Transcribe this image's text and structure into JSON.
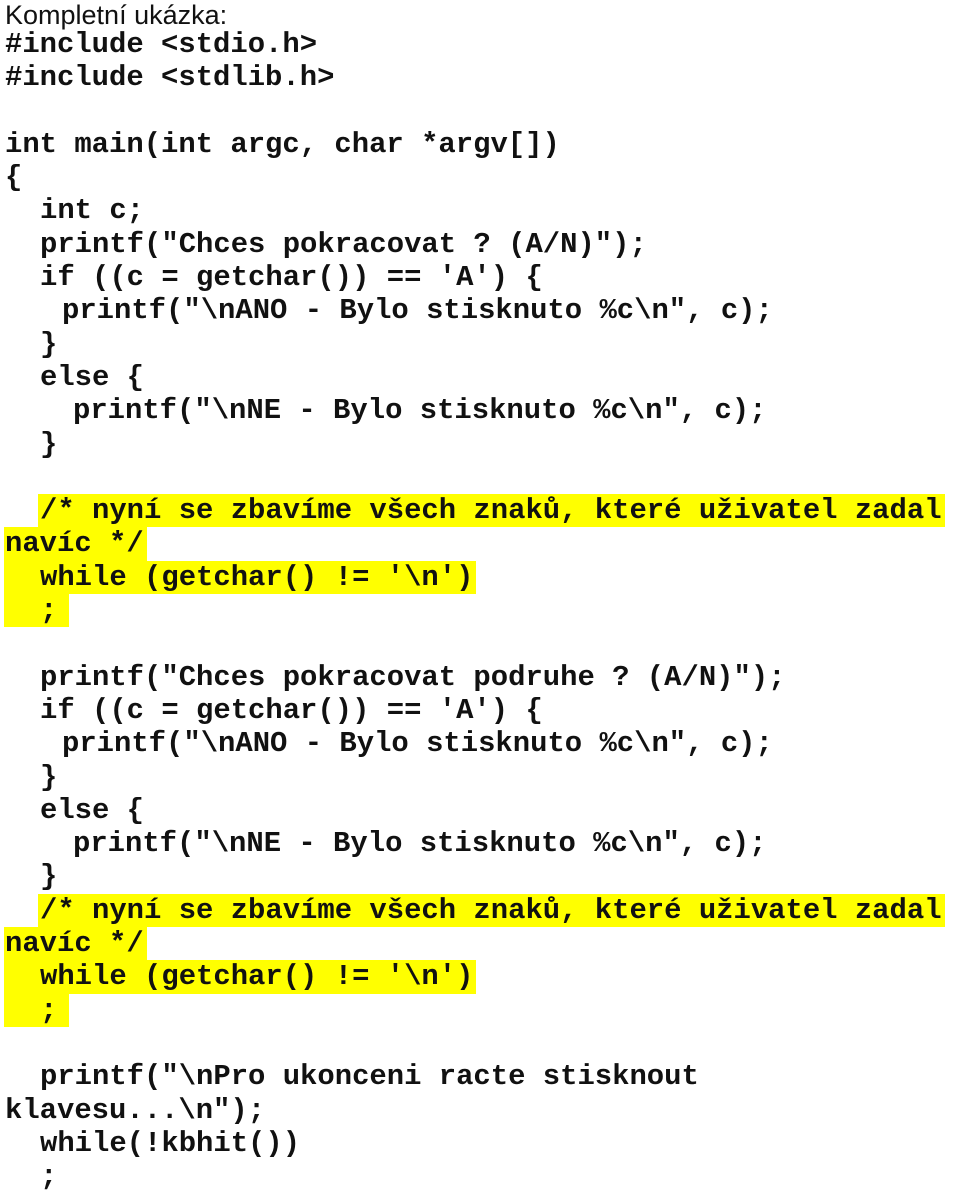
{
  "heading": "Kompletní ukázka:",
  "code": {
    "includes": [
      "#include <stdio.h>",
      "#include <stdlib.h>"
    ],
    "main_signature": "int main(int argc, char *argv[])",
    "open_brace": "{",
    "decl": "int c;",
    "block1": {
      "prompt": "printf(\"Chces pokracovat ? (A/N)\");",
      "if_line": "if ((c = getchar()) == 'A') {",
      "if_body": "printf(\"\\nANO - Bylo stisknuto %c\\n\", c);",
      "close_if": "}",
      "else_line": "else {",
      "else_body": "printf(\"\\nNE - Bylo stisknuto %c\\n\", c);",
      "close_else": "}"
    },
    "highlight1": {
      "comment_part1": "/* nyní se zbavíme všech znaků, které uživatel zadal",
      "comment_part2": "navíc */",
      "while_line": "while (getchar() != '\\n')",
      "semicolon": ";"
    },
    "block2": {
      "prompt": "printf(\"Chces pokracovat podruhe ? (A/N)\");",
      "if_line": "if ((c = getchar()) == 'A') {",
      "if_body": "printf(\"\\nANO - Bylo stisknuto %c\\n\", c);",
      "close_if": "}",
      "else_line": "else {",
      "else_body": "printf(\"\\nNE - Bylo stisknuto %c\\n\", c);",
      "close_else": "}"
    },
    "highlight2": {
      "comment_part1": "/* nyní se zbavíme všech znaků, které uživatel zadal",
      "comment_part2": "navíc */",
      "while_line": "while (getchar() != '\\n')",
      "semicolon": ";"
    },
    "ending": {
      "printf_part1": "printf(\"\\nPro ukonceni racte stisknout",
      "printf_part2": "klavesu...\\n\");",
      "while_line": "while(!kbhit())",
      "semicolon": ";"
    }
  },
  "colors": {
    "highlight": "#ffff00",
    "text": "#111111",
    "background": "#ffffff"
  }
}
